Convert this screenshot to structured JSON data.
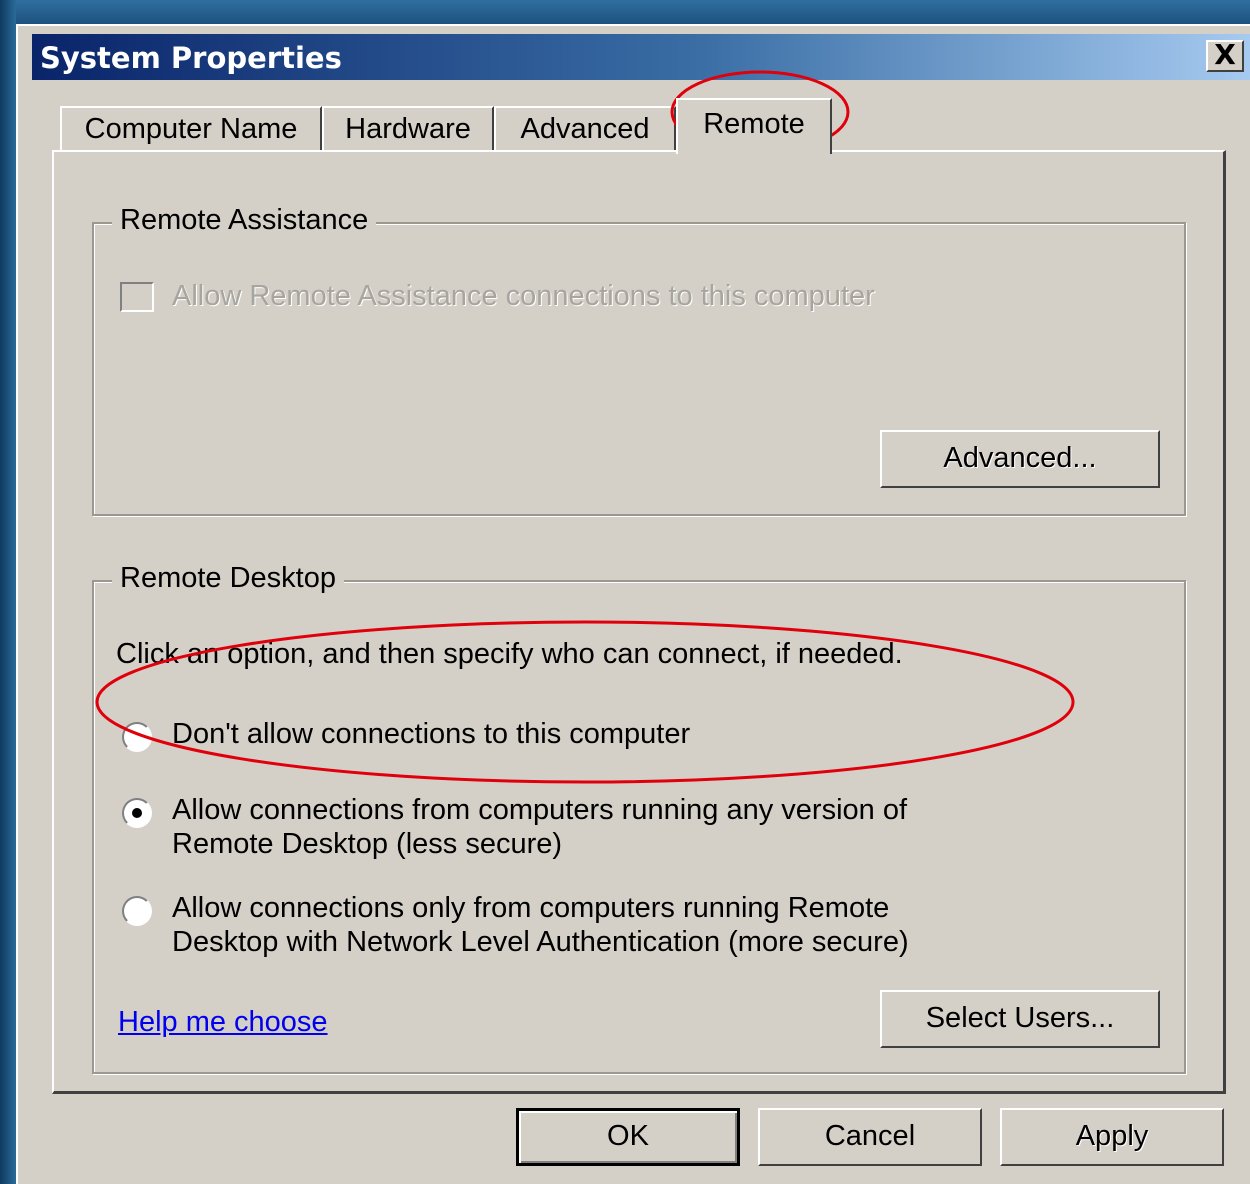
{
  "window": {
    "title": "System Properties",
    "close_glyph": "X"
  },
  "tabs": [
    {
      "label": "Computer Name",
      "active": false
    },
    {
      "label": "Hardware",
      "active": false
    },
    {
      "label": "Advanced",
      "active": false
    },
    {
      "label": "Remote",
      "active": true
    }
  ],
  "remote_assistance": {
    "legend": "Remote Assistance",
    "checkbox_label": "Allow Remote Assistance connections to this computer",
    "checked": false,
    "enabled": false,
    "advanced_button": "Advanced..."
  },
  "remote_desktop": {
    "legend": "Remote Desktop",
    "instruction": "Click an option, and then specify who can connect, if needed.",
    "options": [
      {
        "lines": [
          "Don't allow connections to this computer"
        ],
        "selected": false
      },
      {
        "lines": [
          "Allow connections from computers running any version of",
          "Remote Desktop (less secure)"
        ],
        "selected": true
      },
      {
        "lines": [
          "Allow connections only from computers running Remote",
          "Desktop with Network Level Authentication (more secure)"
        ],
        "selected": false
      }
    ],
    "help_link": "Help me choose",
    "select_users_button": "Select Users..."
  },
  "footer": {
    "ok": "OK",
    "cancel": "Cancel",
    "apply": "Apply"
  },
  "annotation_color": "#e0000b"
}
